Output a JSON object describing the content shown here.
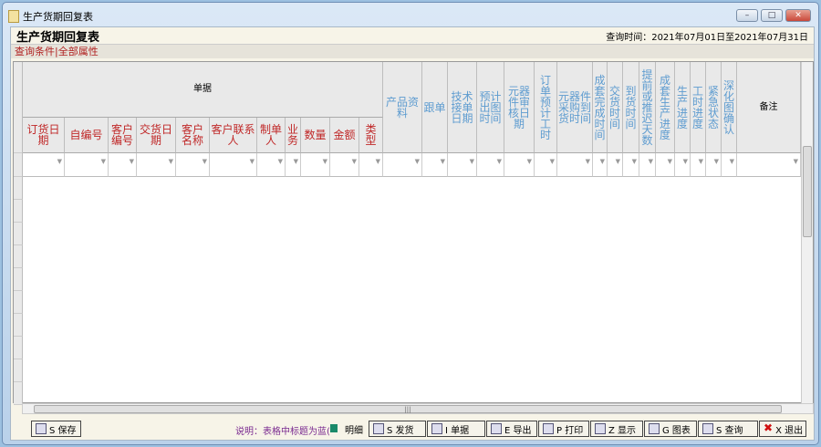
{
  "window": {
    "title": "生产货期回复表",
    "controls": [
      "minimize",
      "maximize",
      "close"
    ]
  },
  "header": {
    "title": "生产货期回复表",
    "query_time": "查询时间：2021年07月01日至2021年07月31日"
  },
  "tabs": [
    "查询条件",
    "全部属性"
  ],
  "table": {
    "group_label": "单据",
    "group_columns": [
      "订货日期",
      "自编号",
      "客户编号",
      "交货日期",
      "客户名称",
      "客户联系人",
      "制单人",
      "业务",
      "数量",
      "金额",
      "类型"
    ],
    "columns": [
      "产品资料",
      "跟单",
      "技术接单日期",
      "预计出图时间",
      "元器件审核日期",
      "订单预计工时",
      "元器件采购到货时间",
      "成套完成时间",
      "交货时间",
      "到货时间",
      "提前或推迟天数",
      "成套生产进度",
      "生产进度",
      "工时进度",
      "紧急状态",
      "深化图确认",
      "备注"
    ],
    "rows": []
  },
  "colors": {
    "group_header": "#c02828",
    "column_header": "#5e9cd0",
    "note": "#7a2a90"
  },
  "footer": {
    "save": "S 保存",
    "note": "说明：表格中标题为蓝(",
    "detail": "明细",
    "buttons": [
      {
        "label": "S 发货",
        "icon": "ship-icon"
      },
      {
        "label": "I 单据",
        "icon": "document-icon"
      },
      {
        "label": "E 导出",
        "icon": "export-icon"
      },
      {
        "label": "P 打印",
        "icon": "print-icon"
      },
      {
        "label": "Z 显示",
        "icon": "display-icon"
      },
      {
        "label": "G 图表",
        "icon": "chart-icon"
      },
      {
        "label": "S 查询",
        "icon": "query-icon"
      },
      {
        "label": "X 退出",
        "icon": "exit-icon"
      }
    ]
  }
}
